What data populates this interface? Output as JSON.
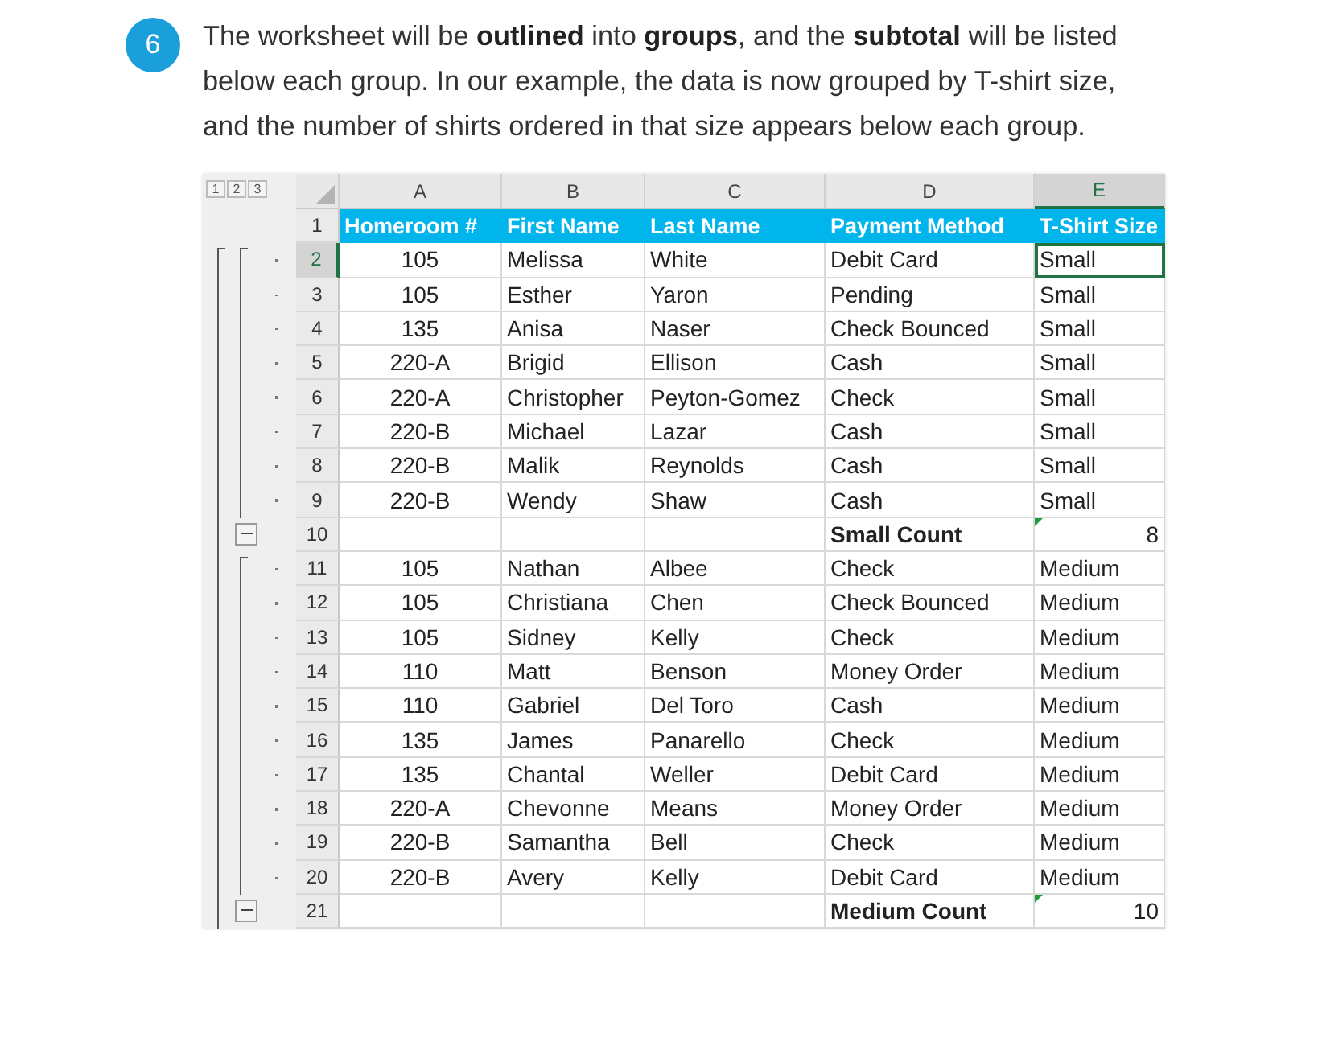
{
  "step": {
    "number": "6",
    "text": "The worksheet will be **outlined** into **groups**, and the **subtotal** will be listed below each group. In our example, the data is now grouped by T-shirt size, and the number of shirts ordered in that size appears below each group."
  },
  "sheet": {
    "outline_levels": [
      "1",
      "2",
      "3"
    ],
    "columns": [
      {
        "label": "A",
        "selected": false
      },
      {
        "label": "B",
        "selected": false
      },
      {
        "label": "C",
        "selected": false
      },
      {
        "label": "D",
        "selected": false
      },
      {
        "label": "E",
        "selected": true
      }
    ],
    "rows": [
      {
        "number": "1",
        "kind": "header",
        "selected": false,
        "cells": [
          "Homeroom #",
          "First Name",
          "Last Name",
          "Payment Method",
          "T-Shirt Size"
        ]
      },
      {
        "number": "2",
        "kind": "detail",
        "selected": true,
        "cells": [
          "105",
          "Melissa",
          "White",
          "Debit Card",
          "Small"
        ]
      },
      {
        "number": "3",
        "kind": "detail",
        "selected": false,
        "cells": [
          "105",
          "Esther",
          "Yaron",
          "Pending",
          "Small"
        ]
      },
      {
        "number": "4",
        "kind": "detail",
        "selected": false,
        "cells": [
          "135",
          "Anisa",
          "Naser",
          "Check Bounced",
          "Small"
        ]
      },
      {
        "number": "5",
        "kind": "detail",
        "selected": false,
        "cells": [
          "220-A",
          "Brigid",
          "Ellison",
          "Cash",
          "Small"
        ]
      },
      {
        "number": "6",
        "kind": "detail",
        "selected": false,
        "cells": [
          "220-A",
          "Christopher",
          "Peyton-Gomez",
          "Check",
          "Small"
        ]
      },
      {
        "number": "7",
        "kind": "detail",
        "selected": false,
        "cells": [
          "220-B",
          "Michael",
          "Lazar",
          "Cash",
          "Small"
        ]
      },
      {
        "number": "8",
        "kind": "detail",
        "selected": false,
        "cells": [
          "220-B",
          "Malik",
          "Reynolds",
          "Cash",
          "Small"
        ]
      },
      {
        "number": "9",
        "kind": "detail",
        "selected": false,
        "cells": [
          "220-B",
          "Wendy",
          "Shaw",
          "Cash",
          "Small"
        ]
      },
      {
        "number": "10",
        "kind": "subtotal",
        "selected": false,
        "label": "Small Count",
        "count": "8"
      },
      {
        "number": "11",
        "kind": "detail",
        "selected": false,
        "cells": [
          "105",
          "Nathan",
          "Albee",
          "Check",
          "Medium"
        ]
      },
      {
        "number": "12",
        "kind": "detail",
        "selected": false,
        "cells": [
          "105",
          "Christiana",
          "Chen",
          "Check Bounced",
          "Medium"
        ]
      },
      {
        "number": "13",
        "kind": "detail",
        "selected": false,
        "cells": [
          "105",
          "Sidney",
          "Kelly",
          "Check",
          "Medium"
        ]
      },
      {
        "number": "14",
        "kind": "detail",
        "selected": false,
        "cells": [
          "110",
          "Matt",
          "Benson",
          "Money Order",
          "Medium"
        ]
      },
      {
        "number": "15",
        "kind": "detail",
        "selected": false,
        "cells": [
          "110",
          "Gabriel",
          "Del Toro",
          "Cash",
          "Medium"
        ]
      },
      {
        "number": "16",
        "kind": "detail",
        "selected": false,
        "cells": [
          "135",
          "James",
          "Panarello",
          "Check",
          "Medium"
        ]
      },
      {
        "number": "17",
        "kind": "detail",
        "selected": false,
        "cells": [
          "135",
          "Chantal",
          "Weller",
          "Debit Card",
          "Medium"
        ]
      },
      {
        "number": "18",
        "kind": "detail",
        "selected": false,
        "cells": [
          "220-A",
          "Chevonne",
          "Means",
          "Money Order",
          "Medium"
        ]
      },
      {
        "number": "19",
        "kind": "detail",
        "selected": false,
        "cells": [
          "220-B",
          "Samantha",
          "Bell",
          "Check",
          "Medium"
        ]
      },
      {
        "number": "20",
        "kind": "detail",
        "selected": false,
        "cells": [
          "220-B",
          "Avery",
          "Kelly",
          "Debit Card",
          "Medium"
        ]
      },
      {
        "number": "21",
        "kind": "subtotal",
        "selected": false,
        "label": "Medium Count",
        "count": "10"
      }
    ]
  }
}
